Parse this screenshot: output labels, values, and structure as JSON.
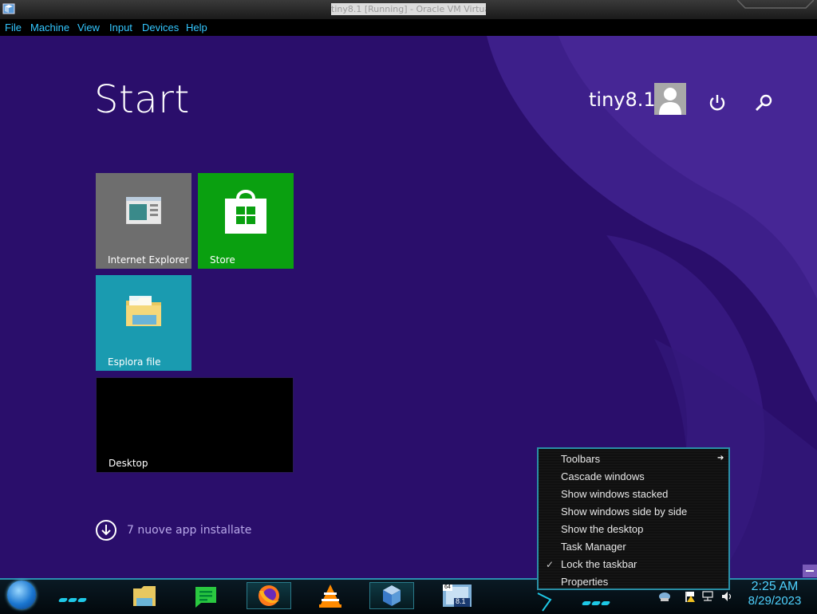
{
  "window": {
    "title": "tiny8.1 [Running] - Oracle VM VirtualBox",
    "menu": [
      "File",
      "Machine",
      "View",
      "Input",
      "Devices",
      "Help"
    ]
  },
  "start": {
    "title": "Start",
    "user": "tiny8.1",
    "icons": [
      "user-avatar-icon",
      "power-icon",
      "search-icon"
    ],
    "tiles": [
      {
        "label": "Internet Explorer",
        "color": "#6e6e6e",
        "icon": "internet-explorer-icon"
      },
      {
        "label": "Store",
        "color": "#0aa010",
        "icon": "store-bag-icon"
      },
      {
        "label": "Esplora file",
        "color": "#1a9bb0",
        "icon": "folder-icon"
      },
      {
        "label": "Desktop",
        "color": "#000000",
        "icon": ""
      }
    ],
    "installed_text": "7 nuove app installate",
    "background_color": "#2a0e6b"
  },
  "context_menu": {
    "items": [
      "Toolbars",
      "Cascade windows",
      "Show windows stacked",
      "Show windows side by side",
      "Show the desktop",
      "Task Manager",
      "Lock the taskbar",
      "Properties"
    ],
    "checked_item": "Lock the taskbar",
    "submenu_item": "Toolbars"
  },
  "taskbar": {
    "pinned_icons": [
      "file-explorer-icon",
      "green-chat-icon",
      "firefox-icon",
      "vlc-icon",
      "virtualbox-icon",
      "windows-8-1-icon"
    ],
    "win81_badge": "8.1",
    "win81_bits": "64",
    "tray_icons": [
      "network-icon",
      "flag-warning-icon",
      "lan-icon",
      "volume-icon"
    ],
    "time": "2:25 AM",
    "date": "8/29/2023",
    "accent_color": "#1ec8e6"
  }
}
